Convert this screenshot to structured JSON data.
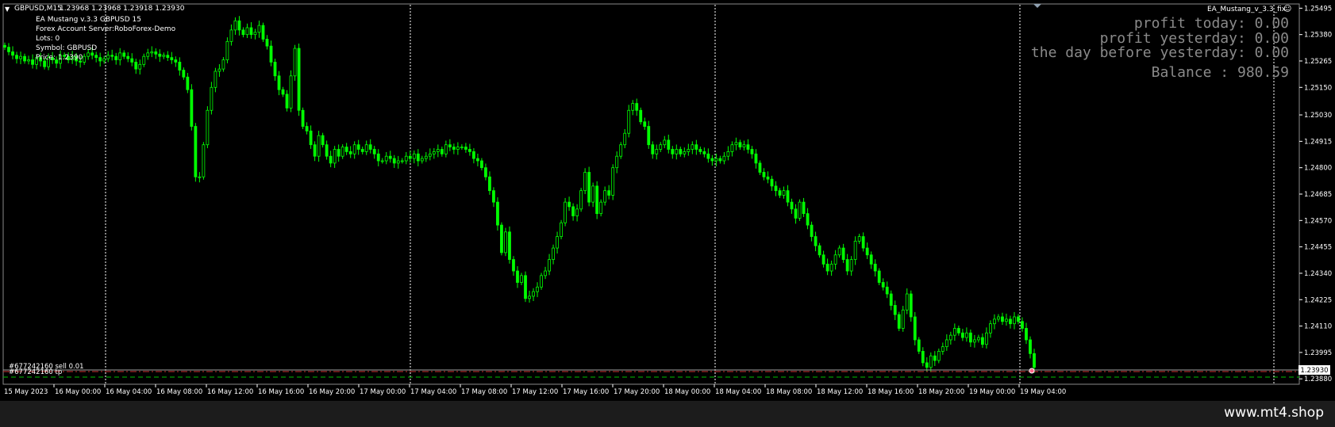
{
  "header": {
    "symbol_timeframe": "GBPUSD,M15",
    "ohlc": "1.23968 1.23968 1.23918 1.23930",
    "expert_name": "EA_Mustang_v_3.3_fix"
  },
  "ea_info": {
    "line1": "EA Mustang v.3.3 GBPUSD  15",
    "line2": "Forex Account Server:RoboForex-Demo",
    "line3": "Lots: 0",
    "line4": "Symbol: GBPUSD",
    "line5": "Price: 1.2390"
  },
  "stats": {
    "profit_today": "profit today: 0.00",
    "profit_yesterday": "profit yesterday: 0.00",
    "day_before": "the day before yesterday: 0.00",
    "balance": "Balance : 980.59"
  },
  "orders": {
    "sell": "#677242160 sell 0.01",
    "tp": "#677242160 tp"
  },
  "current_price": "1.23930",
  "price_ticks": [
    "1.25495",
    "1.25380",
    "1.25265",
    "1.25150",
    "1.25030",
    "1.24915",
    "1.24800",
    "1.24685",
    "1.24570",
    "1.24455",
    "1.24340",
    "1.24225",
    "1.24110",
    "1.23995",
    "1.23880"
  ],
  "time_ticks": [
    "15 May 2023",
    "16 May 00:00",
    "16 May 04:00",
    "16 May 08:00",
    "16 May 12:00",
    "16 May 16:00",
    "16 May 20:00",
    "17 May 00:00",
    "17 May 04:00",
    "17 May 08:00",
    "17 May 12:00",
    "17 May 16:00",
    "17 May 20:00",
    "18 May 00:00",
    "18 May 04:00",
    "18 May 08:00",
    "18 May 12:00",
    "18 May 16:00",
    "18 May 20:00",
    "19 May 00:00",
    "19 May 04:00"
  ],
  "colors": {
    "background": "#000000",
    "candle": "#00ff00",
    "grid": "#ffffff",
    "stats_text": "#8a8a8a",
    "order_line": "#ff0000",
    "tp_line": "#00c000"
  },
  "chart_data": {
    "type": "candlestick",
    "ylim": [
      1.2386,
      1.2551
    ],
    "closes": [
      1.25325,
      1.25305,
      1.2529,
      1.25275,
      1.25285,
      1.25265,
      1.2527,
      1.2525,
      1.2528,
      1.25265,
      1.2524,
      1.2528,
      1.2527,
      1.25255,
      1.2529,
      1.25285,
      1.2527,
      1.25285,
      1.25265,
      1.2526,
      1.25285,
      1.253,
      1.2529,
      1.2528,
      1.25265,
      1.25275,
      1.2529,
      1.25285,
      1.2527,
      1.253,
      1.25285,
      1.25275,
      1.2526,
      1.2523,
      1.2525,
      1.25285,
      1.253,
      1.25305,
      1.25295,
      1.25285,
      1.2529,
      1.2528,
      1.2527,
      1.2526,
      1.25225,
      1.25195,
      1.2514,
      1.2498,
      1.2476,
      1.2476,
      1.249,
      1.2505,
      1.2515,
      1.2522,
      1.2523,
      1.2527,
      1.2535,
      1.254,
      1.2544,
      1.254,
      1.2538,
      1.2541,
      1.2538,
      1.2539,
      1.2542,
      1.2536,
      1.2533,
      1.2526,
      1.252,
      1.2514,
      1.2512,
      1.2506,
      1.252,
      1.2532,
      1.2505,
      1.2498,
      1.2496,
      1.249,
      1.2485,
      1.2494,
      1.249,
      1.2485,
      1.2482,
      1.2488,
      1.2485,
      1.2489,
      1.2487,
      1.2486,
      1.249,
      1.2488,
      1.2487,
      1.249,
      1.2488,
      1.2486,
      1.2483,
      1.2483,
      1.2485,
      1.2484,
      1.2482,
      1.2483,
      1.2483,
      1.2485,
      1.2484,
      1.2486,
      1.2483,
      1.2484,
      1.2485,
      1.2486,
      1.2487,
      1.2488,
      1.2486,
      1.249,
      1.2489,
      1.2488,
      1.2489,
      1.2489,
      1.2488,
      1.2487,
      1.2484,
      1.2483,
      1.248,
      1.2476,
      1.247,
      1.2465,
      1.2455,
      1.2443,
      1.2452,
      1.244,
      1.2435,
      1.243,
      1.2433,
      1.2423,
      1.2424,
      1.2426,
      1.2428,
      1.2433,
      1.2435,
      1.244,
      1.2445,
      1.245,
      1.2456,
      1.2465,
      1.2463,
      1.2459,
      1.2462,
      1.247,
      1.2478,
      1.2465,
      1.2472,
      1.246,
      1.2465,
      1.247,
      1.2468,
      1.248,
      1.2485,
      1.249,
      1.2495,
      1.2505,
      1.2508,
      1.2505,
      1.25,
      1.2498,
      1.249,
      1.2486,
      1.2488,
      1.249,
      1.2492,
      1.2488,
      1.2486,
      1.2488,
      1.2486,
      1.2487,
      1.2488,
      1.249,
      1.2488,
      1.2487,
      1.2486,
      1.2484,
      1.2483,
      1.2484,
      1.2483,
      1.2485,
      1.2487,
      1.249,
      1.2491,
      1.2489,
      1.249,
      1.2488,
      1.2486,
      1.2482,
      1.2478,
      1.2476,
      1.2475,
      1.2472,
      1.247,
      1.2468,
      1.247,
      1.2465,
      1.2462,
      1.2458,
      1.2465,
      1.246,
      1.2455,
      1.245,
      1.2446,
      1.2442,
      1.2438,
      1.2435,
      1.2438,
      1.2442,
      1.2445,
      1.244,
      1.2435,
      1.244,
      1.2448,
      1.245,
      1.2445,
      1.2442,
      1.2438,
      1.2435,
      1.243,
      1.2428,
      1.2425,
      1.242,
      1.2416,
      1.241,
      1.2418,
      1.2425,
      1.2415,
      1.2405,
      1.24,
      1.2395,
      1.2393,
      1.2398,
      1.2396,
      1.24,
      1.2402,
      1.2405,
      1.2407,
      1.241,
      1.2408,
      1.2406,
      1.2408,
      1.2404,
      1.2405,
      1.2406,
      1.2403,
      1.2408,
      1.2412,
      1.2414,
      1.2415,
      1.2413,
      1.2414,
      1.2412,
      1.2415,
      1.2413,
      1.241,
      1.2405,
      1.2399,
      1.2393
    ]
  }
}
